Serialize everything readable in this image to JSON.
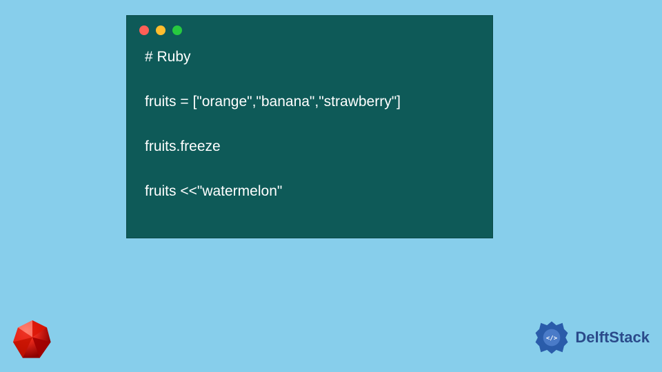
{
  "code": {
    "lines": [
      "# Ruby",
      "",
      "fruits = [\"orange\",\"banana\",\"strawberry\"]",
      "",
      "fruits.freeze",
      "",
      "fruits <<\"watermelon\""
    ]
  },
  "brand": {
    "name": "DelftStack"
  },
  "colors": {
    "page_bg": "#87ceeb",
    "window_bg": "#0e5a58",
    "code_text": "#ffffff",
    "traffic_red": "#ff5f56",
    "traffic_yellow": "#ffbd2e",
    "traffic_green": "#27c93f",
    "brand_text": "#2a4a8a",
    "ruby_red": "#d91404"
  }
}
